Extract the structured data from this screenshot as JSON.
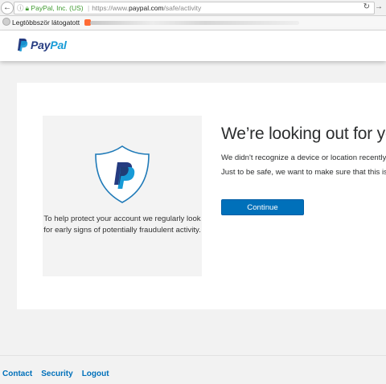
{
  "browser": {
    "site_identity": "PayPal, Inc. (US)",
    "url_scheme": "https://www.",
    "url_host": "paypal.com",
    "url_path": "/safe/activity",
    "bookmark_label": "Legtöbbször látogatott"
  },
  "header": {
    "logo_pay": "Pay",
    "logo_pal": "Pal"
  },
  "aside": {
    "text": "To help protect your account we regularly look for early signs of potentially fraudulent activity."
  },
  "main": {
    "title": "We’re looking out for you",
    "paragraph1": "We didn't recognize a device or location recently use",
    "paragraph2": "Just to be safe, we want to make sure that this is you",
    "continue_label": "Continue"
  },
  "footer": {
    "links": [
      "Contact",
      "Security",
      "Logout"
    ]
  },
  "colors": {
    "brand_dark": "#253b80",
    "brand_light": "#179bd7",
    "button": "#0070ba"
  }
}
